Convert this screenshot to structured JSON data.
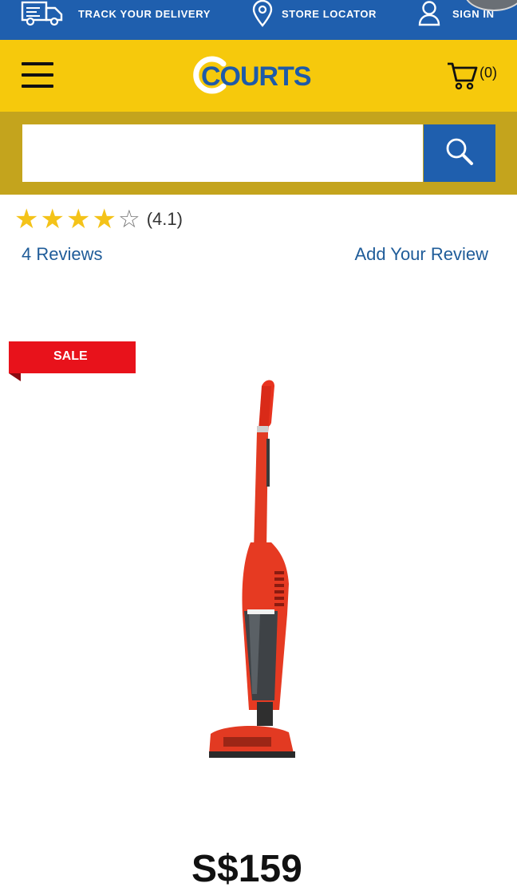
{
  "topbar": {
    "track_label": "TRACK YOUR DELIVERY",
    "track_icon": "delivery-truck-icon",
    "store_label": "STORE LOCATOR",
    "store_icon": "location-pin-icon",
    "sign_in_label": "SIGN IN",
    "sign_in_icon": "user-icon"
  },
  "header": {
    "logo_text": "COURTS",
    "cart_count": "(0)",
    "menu_icon": "hamburger-menu-icon",
    "cart_icon": "shopping-cart-icon"
  },
  "search": {
    "placeholder": "",
    "value": "",
    "icon": "search-icon"
  },
  "rating": {
    "stars_filled": 4,
    "stars_total": 5,
    "value_text": "(4.1)",
    "reviews_link": "4 Reviews",
    "add_review_link": "Add Your Review"
  },
  "product": {
    "badge": "SALE",
    "image": "red-stick-vacuum-cleaner",
    "price_text": "S$159"
  },
  "colors": {
    "topbar_blue": "#1f5fae",
    "header_yellow": "#f6c90c",
    "search_band": "#c4a41d",
    "link_blue": "#1f5c99",
    "sale_red": "#e8121b",
    "star_gold": "#f4c319"
  }
}
